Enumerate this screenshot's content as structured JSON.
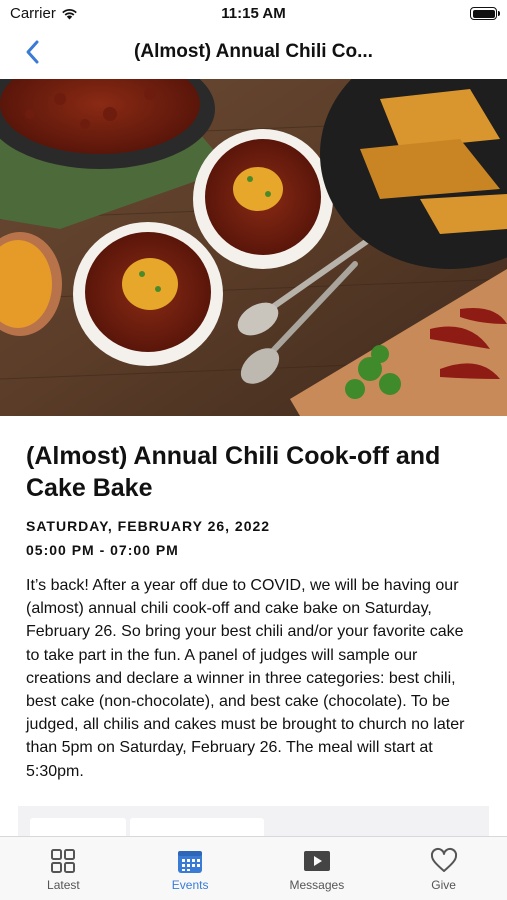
{
  "status": {
    "carrier": "Carrier",
    "time": "11:15 AM"
  },
  "nav": {
    "title": "(Almost) Annual Chili Co..."
  },
  "event": {
    "title": "(Almost) Annual Chili Cook-off and Cake Bake",
    "date": "SATURDAY, FEBRUARY 26, 2022",
    "time": "05:00 PM - 07:00 PM",
    "description": "It’s back! After a year off due to COVID, we will be having our (almost) annual chili cook-off and cake bake on Saturday, February 26. So bring your best chili and/or your favorite cake to take part in the fun. A panel of judges will sample our creations and declare a winner in three categories: best chili, best cake (non-chocolate), and best cake (chocolate). To be judged, all chilis and cakes must be brought to church no later than 5pm on Saturday, February 26. The meal will start at 5:30pm."
  },
  "tabs": [
    {
      "label": "Latest",
      "icon": "grid-icon"
    },
    {
      "label": "Events",
      "icon": "calendar-icon"
    },
    {
      "label": "Messages",
      "icon": "play-icon"
    },
    {
      "label": "Give",
      "icon": "heart-icon"
    }
  ],
  "colors": {
    "accent": "#3a7bd5",
    "tab_inactive": "#555555"
  }
}
